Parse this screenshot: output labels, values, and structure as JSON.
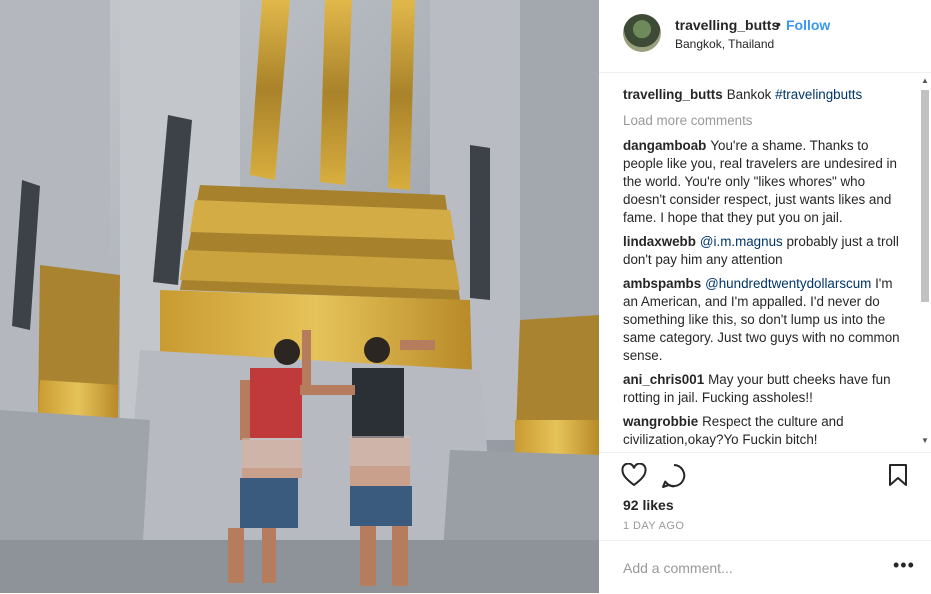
{
  "header": {
    "username": "travelling_butts",
    "separator": "•",
    "follow_label": "Follow",
    "location": "Bangkok, Thailand"
  },
  "caption": {
    "user": "travelling_butts",
    "text": "Bankok",
    "hashtag": "#travelingbutts"
  },
  "load_more_label": "Load more comments",
  "comments": [
    {
      "user": "dangamboab",
      "mention": "",
      "text": "You're a shame. Thanks to people like you, real travelers are undesired in the world. You're only \"likes whores\" who doesn't consider respect, just wants likes and fame. I hope that they put you on jail."
    },
    {
      "user": "lindaxwebb",
      "mention": "@i.m.magnus",
      "text": "probably just a troll don't pay him any attention"
    },
    {
      "user": "ambspambs",
      "mention": "@hundredtwentydollarscum",
      "text": "I'm an American, and I'm appalled. I'd never do something like this, so don't lump us into the same category. Just two guys with no common sense."
    },
    {
      "user": "ani_chris001",
      "mention": "",
      "text": "May your butt cheeks have fun rotting in jail. Fucking assholes!!"
    },
    {
      "user": "wangrobbie",
      "mention": "",
      "text": "Respect the culture and civilization,okay?Yo Fuckin bitch!"
    }
  ],
  "likes": "92 likes",
  "date": "1 DAY AGO",
  "add_comment": {
    "placeholder": "Add a comment..."
  },
  "more_options": "•••",
  "icons": {
    "like": "heart-icon",
    "comment": "comment-icon",
    "save": "bookmark-icon"
  },
  "colors": {
    "link": "#3897f0",
    "tag": "#003569",
    "muted": "#999999"
  }
}
